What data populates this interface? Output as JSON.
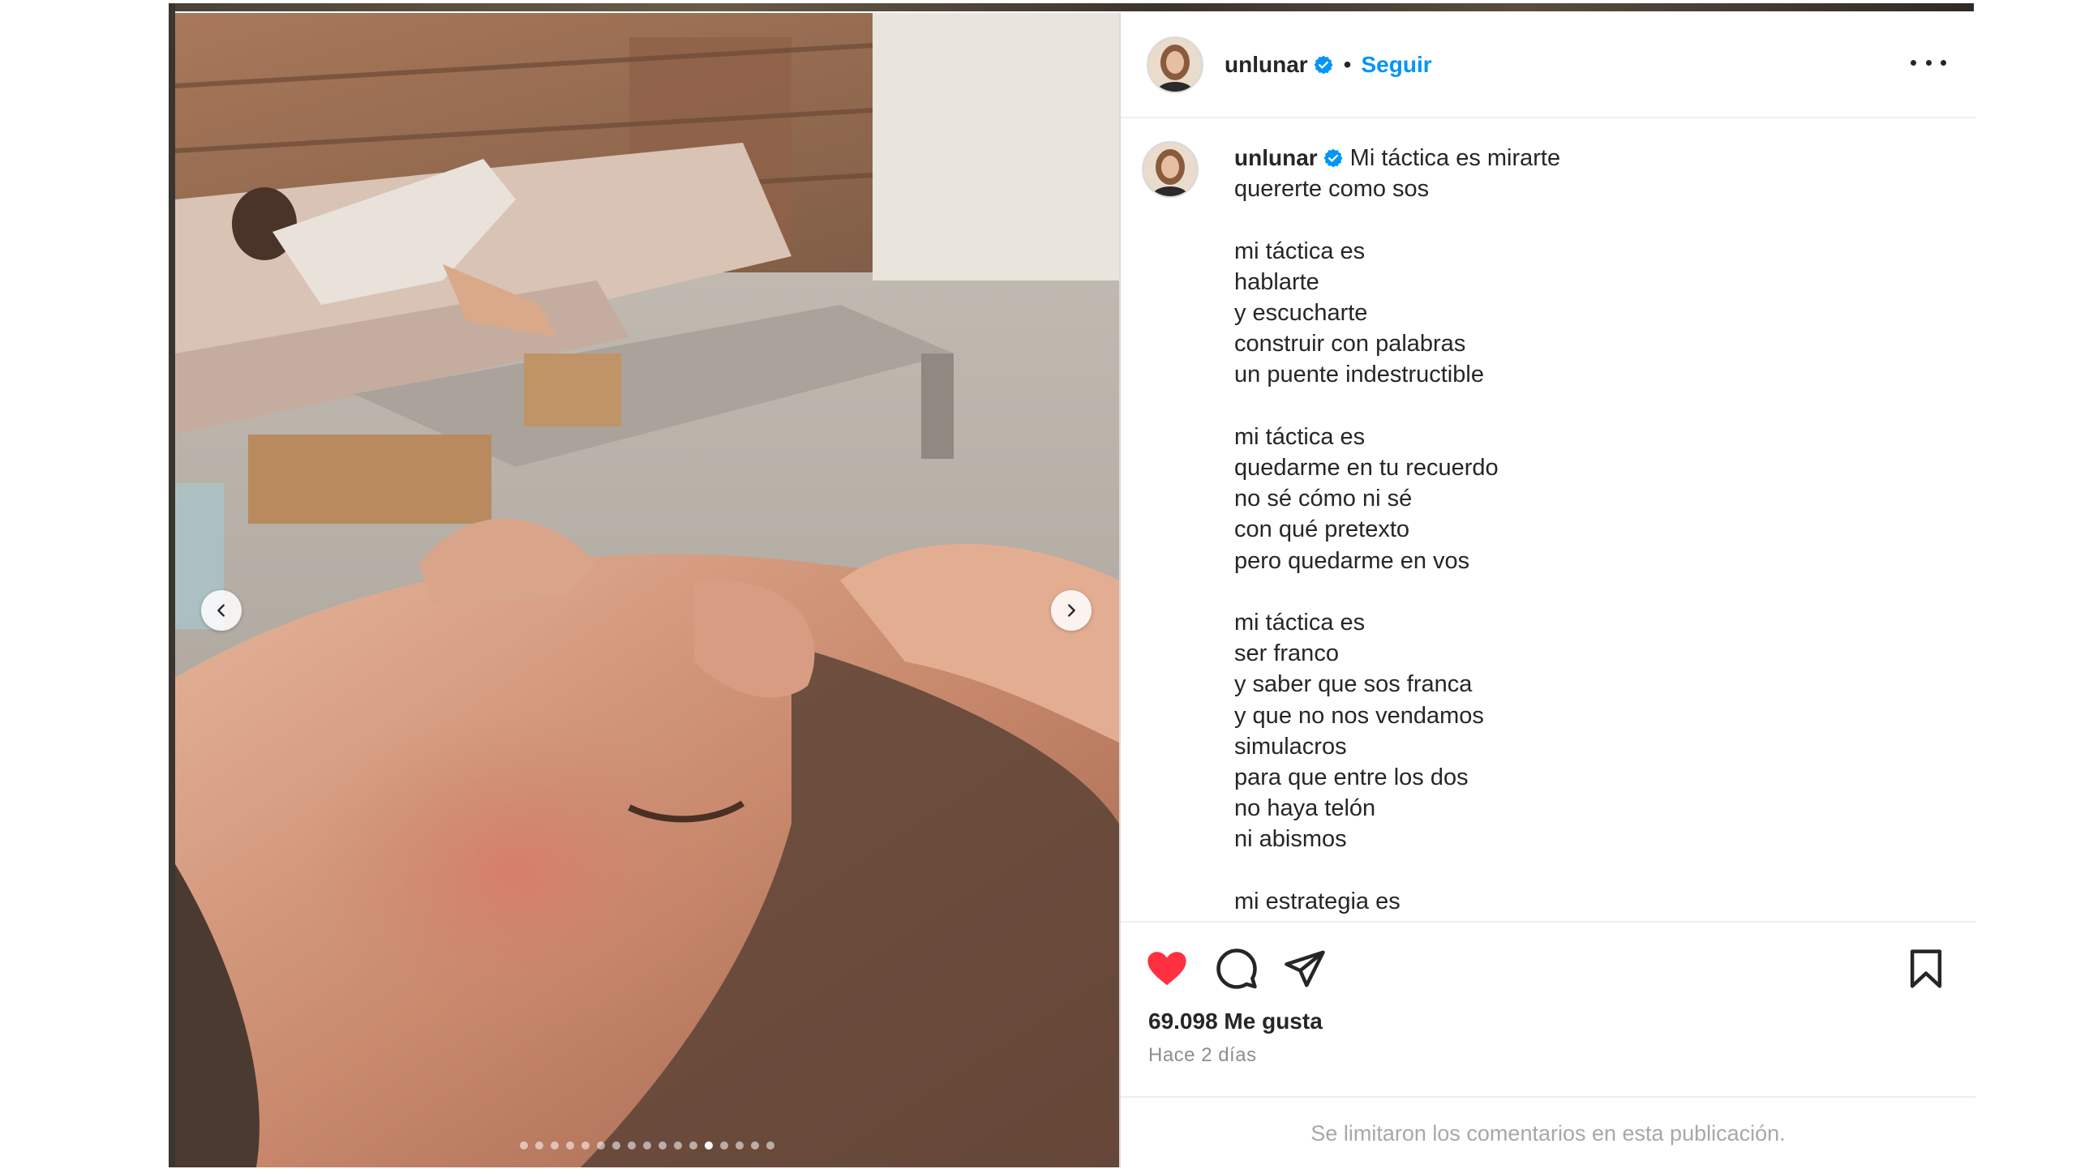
{
  "post": {
    "username": "unlunar",
    "follow_label": "Seguir",
    "separator": "•",
    "caption_first_line": "Mi táctica es mirarte",
    "caption_rest": "quererte como sos\n\nmi táctica es\nhablarte\ny escucharte\nconstruir con palabras\nun puente indestructible\n\nmi táctica es\nquedarme en tu recuerdo\nno sé cómo ni sé\ncon qué pretexto\npero quedarme en vos\n\nmi táctica es\nser franco\ny saber que sos franca\ny que no nos vendamos\nsimulacros\npara que entre los dos\nno haya telón\nni abismos\n\nmi estrategia es",
    "likes_text": "69.098 Me gusta",
    "time_text": "Hace 2 días",
    "comments_notice": "Se limitaron los comentarios en esta publicación."
  },
  "carousel": {
    "total_slides": 17,
    "active_index": 12
  },
  "colors": {
    "accent": "#0095f6",
    "like": "#ff3040",
    "verified": "#0095f6"
  },
  "icons": [
    "verified-badge-icon",
    "more-options-icon",
    "chevron-left-icon",
    "chevron-right-icon",
    "heart-icon",
    "comment-icon",
    "share-icon",
    "bookmark-icon"
  ]
}
